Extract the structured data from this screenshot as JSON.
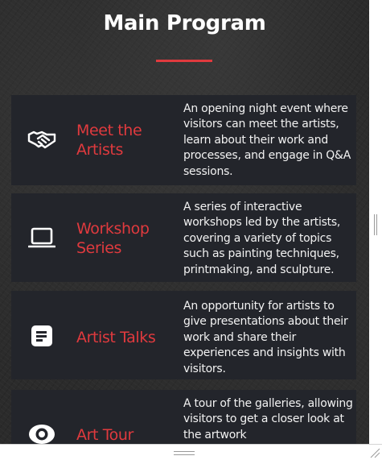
{
  "page": {
    "title": "Main Program"
  },
  "program": [
    {
      "icon": "handshake-icon",
      "title": "Meet the Artists",
      "description": "An opening night event where visitors can meet the artists, learn about their work and processes, and engage in Q&A sessions."
    },
    {
      "icon": "laptop-icon",
      "title": "Workshop Series",
      "description": "A series of interactive workshops led by the artists, covering a variety of topics such as painting techniques, printmaking, and sculpture."
    },
    {
      "icon": "document-icon",
      "title": "Artist Talks",
      "description": "An opportunity for artists to give presentations about their work and share their experiences and insights with visitors."
    },
    {
      "icon": "eye-icon",
      "title": "Art Tour",
      "description": "A tour of the galleries, allowing visitors to get a closer look at the artwork"
    }
  ],
  "colors": {
    "accent": "#e03a3e",
    "card_background": "#23252b",
    "page_background": "#2b2b2b",
    "text": "#f2f2f2"
  }
}
